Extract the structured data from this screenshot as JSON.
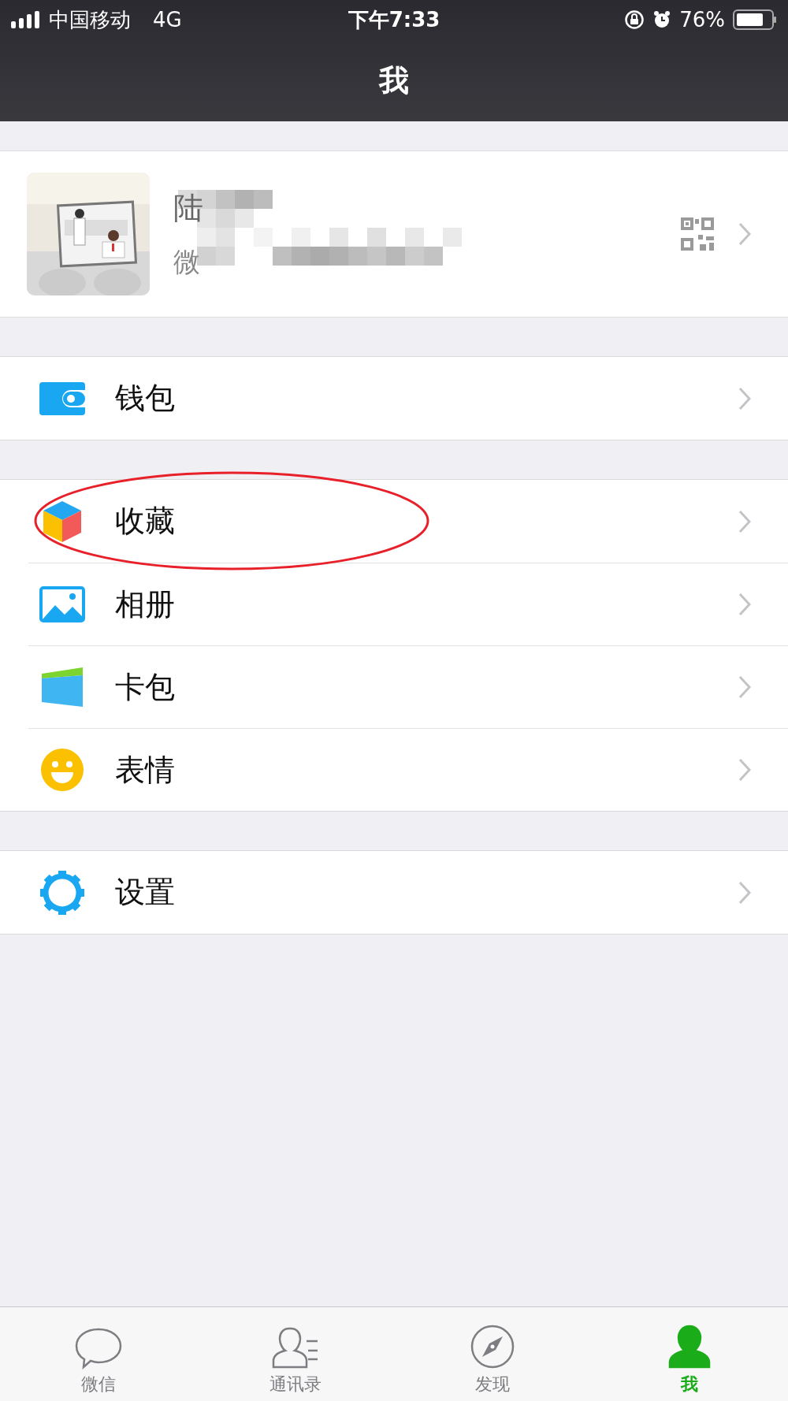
{
  "status_bar": {
    "carrier": "中国移动",
    "network": "4G",
    "time": "下午7:33",
    "battery": "76%"
  },
  "nav_bar": {
    "title": "我"
  },
  "profile": {
    "name": "陆",
    "wechat_id": "微"
  },
  "menu_groups": [
    [
      {
        "kind": "wallet",
        "label": "钱包",
        "circled": false
      }
    ],
    [
      {
        "kind": "favorites",
        "label": "收藏",
        "circled": true
      },
      {
        "kind": "album",
        "label": "相册",
        "circled": false
      },
      {
        "kind": "cards",
        "label": "卡包",
        "circled": false
      },
      {
        "kind": "stickers",
        "label": "表情",
        "circled": false
      }
    ],
    [
      {
        "kind": "settings",
        "label": "设置",
        "circled": false
      }
    ]
  ],
  "tabs": [
    {
      "kind": "chats",
      "label": "微信",
      "selected": false
    },
    {
      "kind": "contacts",
      "label": "通讯录",
      "selected": false
    },
    {
      "kind": "discover",
      "label": "发现",
      "selected": false
    },
    {
      "kind": "me",
      "label": "我",
      "selected": true
    }
  ]
}
